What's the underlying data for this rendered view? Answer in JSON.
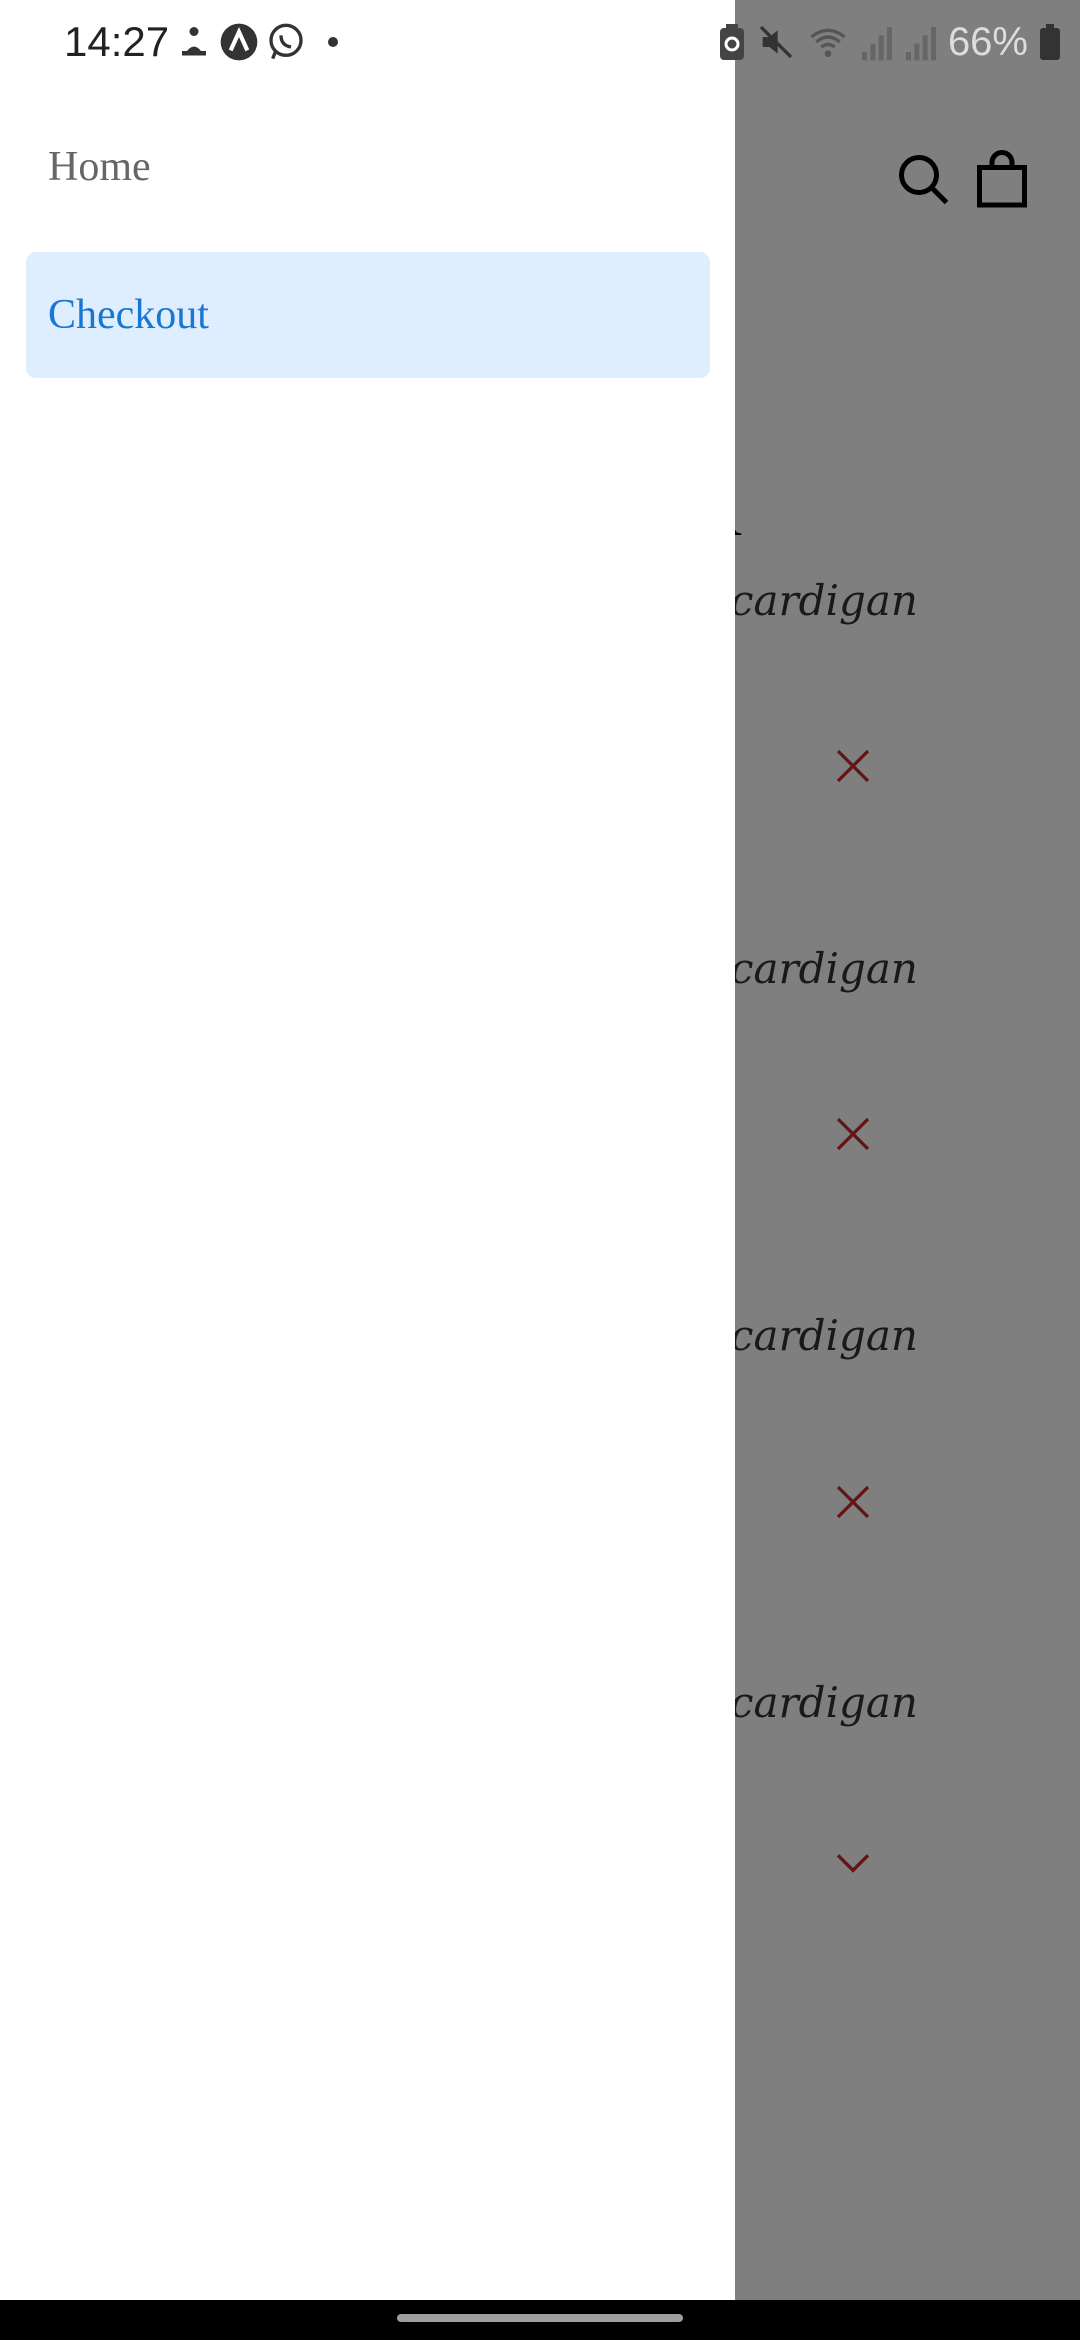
{
  "status_bar": {
    "time": "14:27",
    "battery": "66%",
    "notification_icons": [
      "person-meditation-icon",
      "app-logo-icon",
      "whatsapp-icon",
      "dot-icon"
    ],
    "system_icons": [
      "battery-saver-icon",
      "mute-icon",
      "wifi-icon",
      "signal-icon",
      "signal-icon",
      "battery-icon"
    ]
  },
  "drawer": {
    "items": [
      {
        "label": "Home",
        "active": false
      },
      {
        "label": "Checkout",
        "active": true
      }
    ],
    "active_bg": "#deeeff",
    "active_color": "#1976d2"
  },
  "background_page": {
    "heading_fragment": "R",
    "items": [
      {
        "name_fragment": "cardigan",
        "action_icon": "close-icon"
      },
      {
        "name_fragment": "cardigan",
        "action_icon": "close-icon"
      },
      {
        "name_fragment": "cardigan",
        "action_icon": "close-icon"
      },
      {
        "name_fragment": "cardigan",
        "action_icon": "chevron-down-icon"
      }
    ],
    "accent": "#c62828"
  }
}
